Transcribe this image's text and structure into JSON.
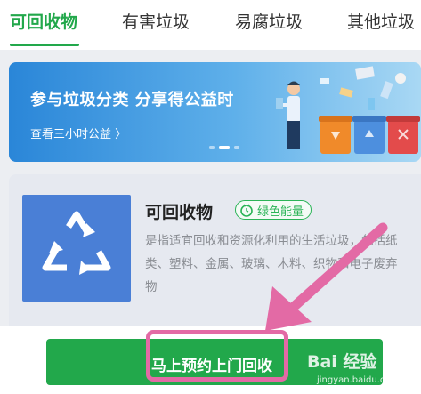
{
  "tabs": [
    {
      "label": "可回收物",
      "active": true
    },
    {
      "label": "有害垃圾",
      "active": false
    },
    {
      "label": "易腐垃圾",
      "active": false
    },
    {
      "label": "其他垃圾",
      "active": false
    }
  ],
  "banner": {
    "title": "参与垃圾分类 分享得公益时",
    "link": "查看三小时公益 〉",
    "page": 2,
    "pages": 3
  },
  "category": {
    "title": "可回收物",
    "badge": "绿色能量",
    "description": "是指适宜回收和资源化利用的生活垃圾，包括纸类、塑料、金属、玻璃、木料、织物和电子废弃物"
  },
  "cta": {
    "label": "马上预约上门回收"
  },
  "watermark": {
    "main": "Bai 经验",
    "sub": "jingyan.baidu.com"
  },
  "colors": {
    "accent": "#22a84b",
    "banner": "#2a86d8",
    "icon_bg": "#4a7fd6",
    "annotation": "#e36aa5"
  }
}
